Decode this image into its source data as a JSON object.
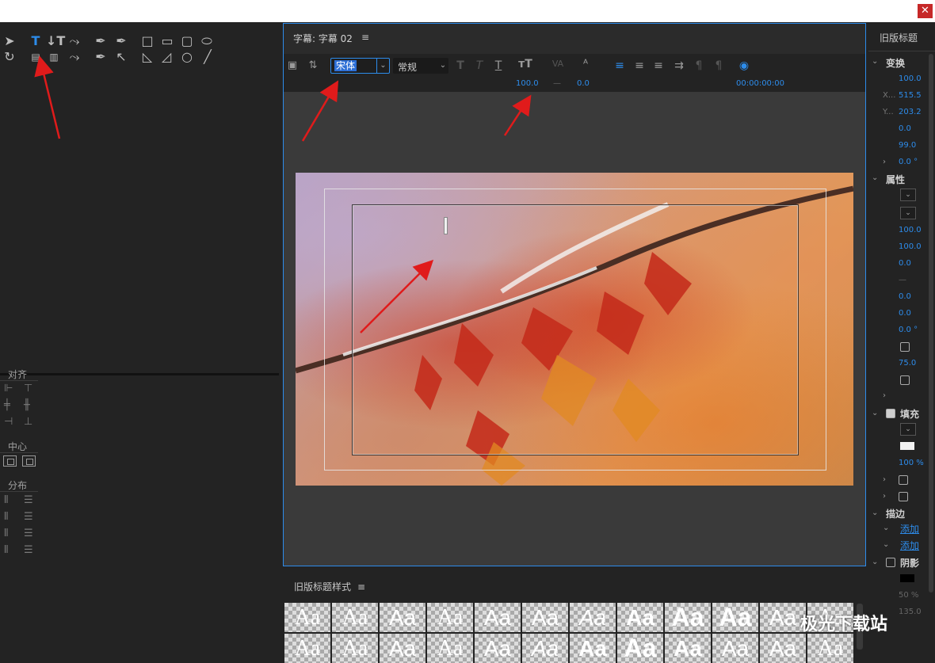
{
  "window": {
    "close_label": "✕"
  },
  "center": {
    "title": "字幕: 字幕 02",
    "menu": "≡",
    "toolbar": {
      "font_name": "宋体",
      "font_style": "常规",
      "font_size_value": "100.0",
      "kerning_value": "—",
      "leading_value": "0.0",
      "tab_time": "00:00:00:00"
    }
  },
  "left": {
    "align_label": "对齐",
    "center_label": "中心",
    "distribute_label": "分布"
  },
  "bottom": {
    "title": "旧版标题样式",
    "menu": "≡",
    "swatch_text": "Aa"
  },
  "right": {
    "title": "旧版标题",
    "transform_label": "变换",
    "transform_values": [
      "100.0",
      "515.5",
      "203.2",
      "0.0",
      "99.0",
      "0.0 °"
    ],
    "x_label": "X...",
    "y_label": "Y...",
    "properties_label": "属性",
    "properties_values": [
      "100.0",
      "100.0",
      "0.0",
      "—",
      "0.0",
      "0.0",
      "0.0 °"
    ],
    "opacity_value": "75.0",
    "fill_label": "填充",
    "fill_opacity": "100 %",
    "stroke_label": "描边",
    "add_label_1": "添加",
    "add_label_2": "添加",
    "shadow_label": "阴影",
    "shadow_opacity": "50 %",
    "shadow_angle": "135.0"
  },
  "watermark": "极光下载站",
  "colors": {
    "accent": "#2d8ceb",
    "arrow": "#e01b1b",
    "close": "#c62828"
  }
}
